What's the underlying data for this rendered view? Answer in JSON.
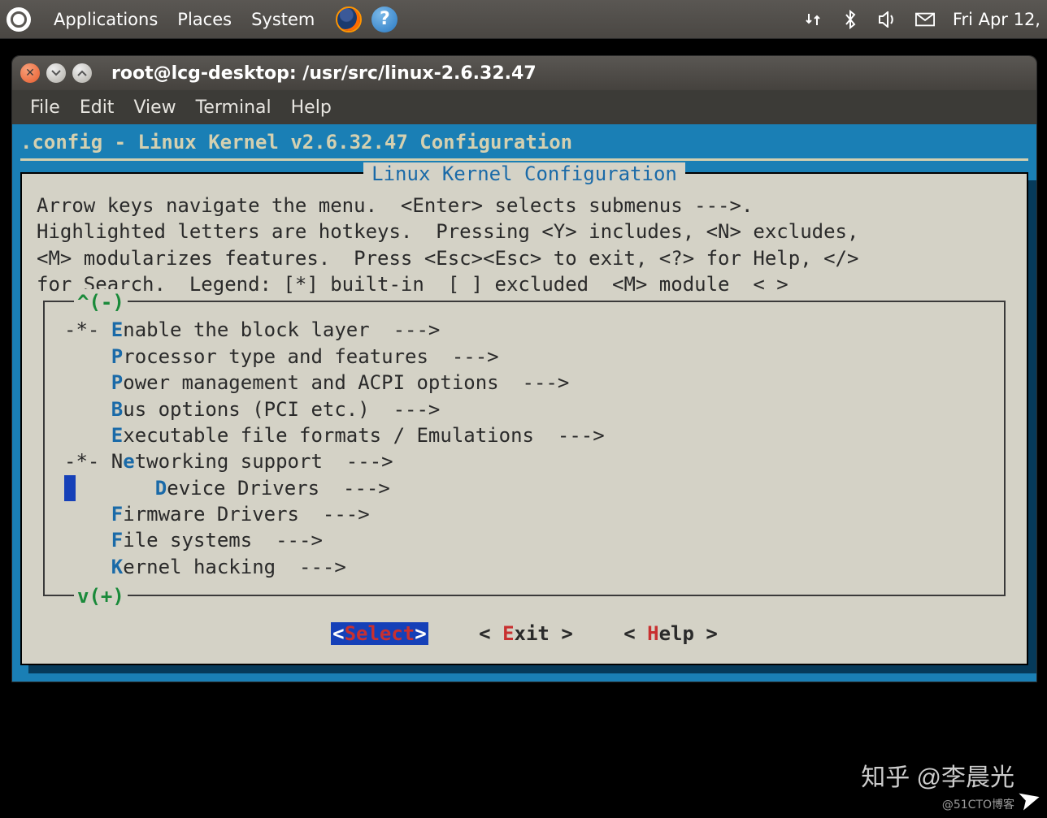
{
  "topbar": {
    "menu": [
      "Applications",
      "Places",
      "System"
    ],
    "clock": "Fri Apr 12,"
  },
  "window": {
    "title": "root@lcg-desktop: /usr/src/linux-2.6.32.47",
    "menubar": [
      "File",
      "Edit",
      "View",
      "Terminal",
      "Help"
    ]
  },
  "config": {
    "header": ".config - Linux Kernel v2.6.32.47 Configuration",
    "box_title": "Linux Kernel Configuration",
    "help1": "Arrow keys navigate the menu.  <Enter> selects submenus --->.",
    "help2": "Highlighted letters are hotkeys.  Pressing <Y> includes, <N> excludes,",
    "help3": "<M> modularizes features.  Press <Esc><Esc> to exit, <?> for Help, </>",
    "help4": "for Search.  Legend: [*] built-in  [ ] excluded  <M> module  < >",
    "scroll_up": "^(-)",
    "scroll_down": "v(+)",
    "items": [
      {
        "prefix": "-*- ",
        "hotkey": "E",
        "label": "nable the block layer  --->"
      },
      {
        "prefix": "    ",
        "hotkey": "P",
        "label": "rocessor type and features  --->"
      },
      {
        "prefix": "    ",
        "hotkey": "P",
        "label": "ower management and ACPI options  --->"
      },
      {
        "prefix": "    ",
        "hotkey": "B",
        "label": "us options (PCI etc.)  --->"
      },
      {
        "prefix": "    ",
        "hotkey": "E",
        "label": "xecutable file formats / Emulations  --->"
      },
      {
        "prefix": "-*- N",
        "hotkey": "e",
        "label": "tworking support  --->"
      },
      {
        "prefix": "    ",
        "hotkey": "D",
        "label": "evice Drivers  --->",
        "selected": true
      },
      {
        "prefix": "    ",
        "hotkey": "F",
        "label": "irmware Drivers  --->"
      },
      {
        "prefix": "    ",
        "hotkey": "F",
        "label": "ile systems  --->"
      },
      {
        "prefix": "    ",
        "hotkey": "K",
        "label": "ernel hacking  --->"
      }
    ],
    "buttons": {
      "select": "Select",
      "exit_hot": "E",
      "exit": "xit",
      "help_hot": "H",
      "help": "elp"
    }
  },
  "watermark": "知乎 @李晨光",
  "watermark2": "@51CTO博客"
}
